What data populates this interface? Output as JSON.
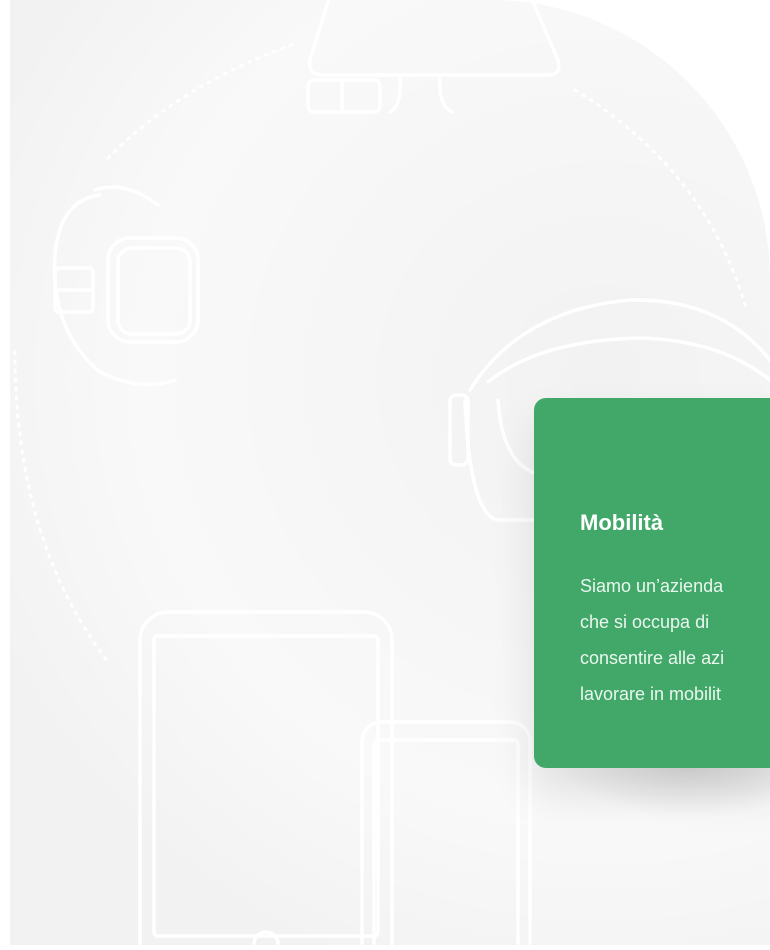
{
  "card": {
    "title": "Mobilità",
    "lines": [
      "Siamo un’azienda",
      "che si occupa di",
      "consentire alle azi",
      "lavorare in mobilit"
    ]
  },
  "colors": {
    "background": "#f2f2f2",
    "card": "#41a86a",
    "line_art": "#ffffff"
  },
  "icons": [
    "smart-glasses-icon",
    "smartwatch-icon",
    "vr-headset-icon",
    "tablet-icon",
    "smartphone-icon"
  ]
}
